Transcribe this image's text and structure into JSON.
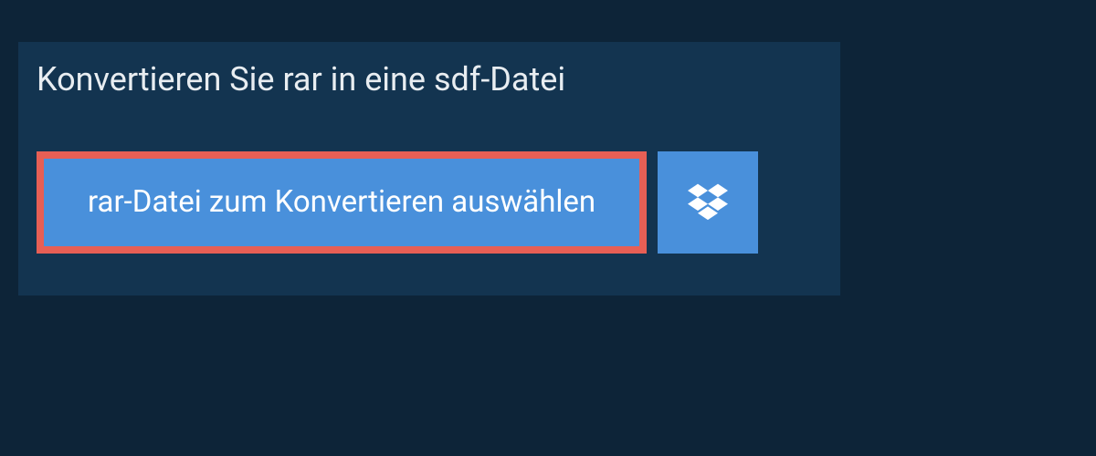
{
  "header": {
    "title": "Konvertieren Sie rar in eine sdf-Datei"
  },
  "actions": {
    "select_file_label": "rar-Datei zum Konvertieren auswählen"
  }
}
